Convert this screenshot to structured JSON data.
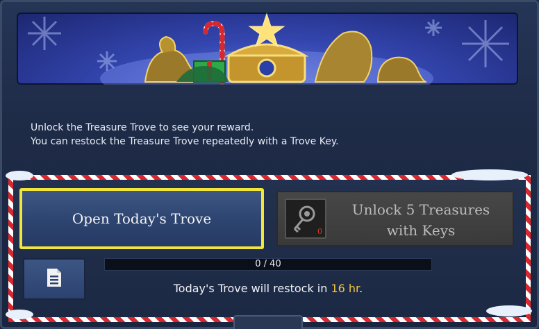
{
  "info": {
    "line1": "Unlock the Treasure Trove to see your reward.",
    "line2": "You can restock the Treasure Trove repeatedly with a Trove Key."
  },
  "buttons": {
    "open_label": "Open Today's Trove",
    "unlock_line1": "Unlock 5 Treasures",
    "unlock_line2": "with Keys",
    "key_count": "0"
  },
  "progress": {
    "current": 0,
    "max": 40,
    "label": "0 / 40"
  },
  "restock": {
    "prefix": "Today's Trove will restock in ",
    "value": "16 hr",
    "suffix": "."
  },
  "icons": {
    "document": "document-icon",
    "key": "trove-key-icon"
  },
  "colors": {
    "highlight": "#f2e63a",
    "accent_time": "#f3c73a",
    "candy_red": "#d8282e"
  }
}
